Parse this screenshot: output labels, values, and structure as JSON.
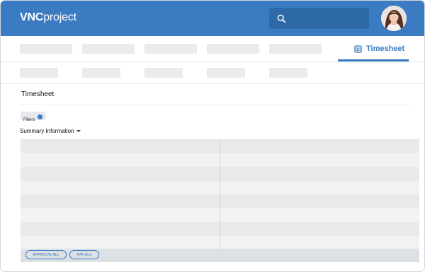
{
  "brand": {
    "vnc": "VNC",
    "project": "project"
  },
  "header": {
    "search_icon": "search-icon",
    "avatar": "user-avatar"
  },
  "tabs": {
    "active_label": "Timesheet",
    "active_icon": "calendar-table-icon"
  },
  "page": {
    "title": "Timesheet"
  },
  "filters": {
    "label": "Filters"
  },
  "summary": {
    "label": "Summary Information"
  },
  "table": {
    "rows": 8,
    "buttons": {
      "approve_all": "APPROVE ALL",
      "pay_all": "PAY ALL"
    }
  },
  "colors": {
    "brand": "#3a7bc2",
    "search_bg": "#2f6aa8"
  }
}
